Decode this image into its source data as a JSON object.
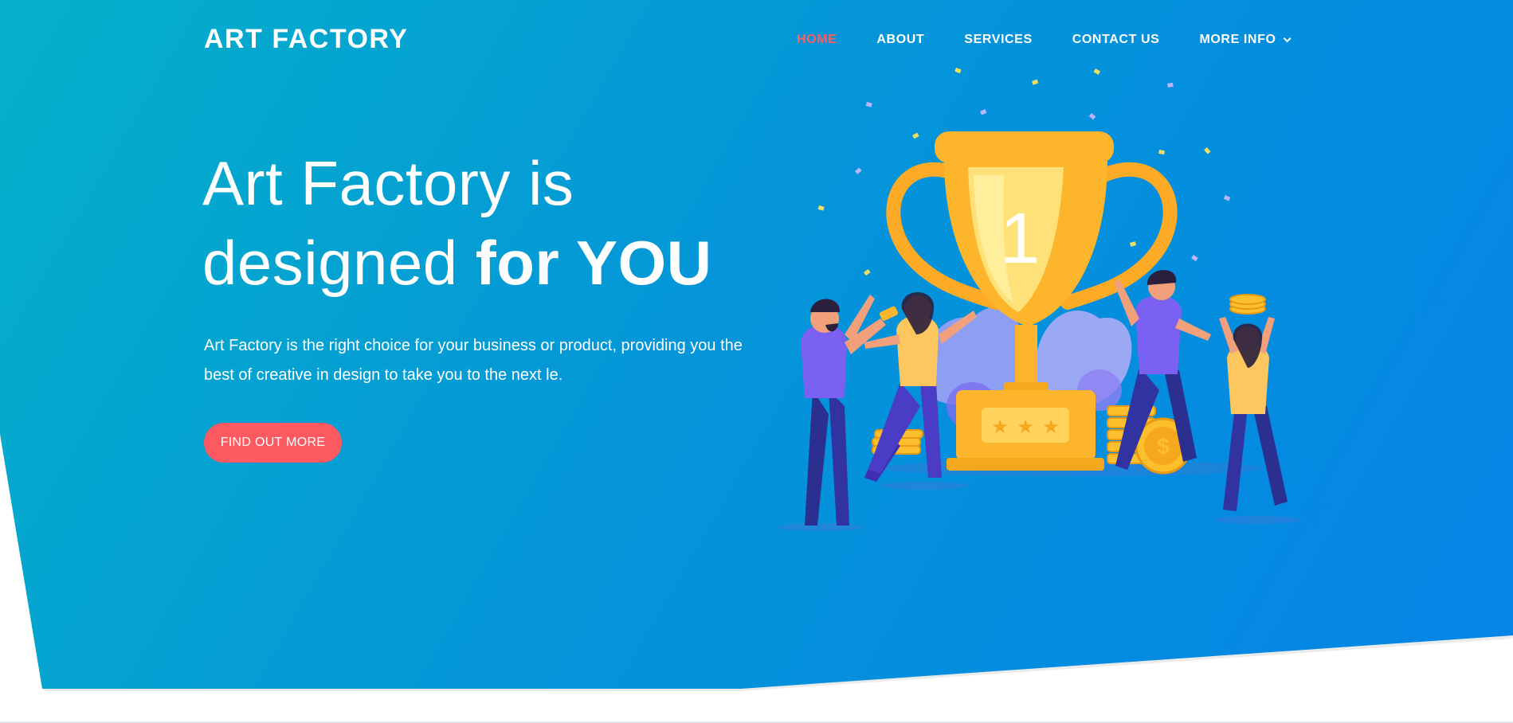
{
  "brand": {
    "logo_text": "ART FACTORY"
  },
  "nav": {
    "items": [
      {
        "label": "HOME",
        "active": true
      },
      {
        "label": "ABOUT"
      },
      {
        "label": "SERVICES"
      },
      {
        "label": "CONTACT US"
      },
      {
        "label": "MORE INFO"
      }
    ]
  },
  "hero": {
    "headline_line1": "Art Factory is",
    "headline_line2_regular": "designed ",
    "headline_line2_bold": "for YOU",
    "lead": "Art Factory is the right choice for your business or product, providing you the best of creative in design to take you to the next le.",
    "cta_label": "FIND OUT MORE",
    "trophy_number": "1"
  },
  "colors": {
    "accent": "#fc5961",
    "gradient_start": "#04b1c9",
    "gradient_end": "#0584e6",
    "trophy": "#fdb52b"
  },
  "icons": {
    "dropdown": "chevron-down-icon"
  }
}
